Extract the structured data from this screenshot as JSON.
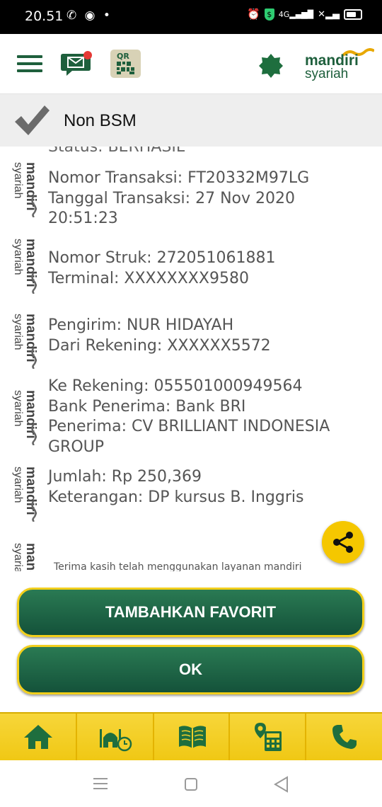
{
  "status_bar": {
    "time": "20.51",
    "left_icons": [
      "whatsapp-icon",
      "media-icon",
      "dot-icon"
    ],
    "right_icons": [
      "alarm-icon",
      "shield-icon",
      "signal-4g-icon",
      "signal-x-icon",
      "battery-icon"
    ],
    "network_label": "4G"
  },
  "header": {
    "menu_icon": "hamburger-icon",
    "mail_icon": "mail-notification-icon",
    "qr_label": "QR",
    "brand_name": "mandiri",
    "brand_sub": "syariah"
  },
  "section": {
    "title": "Non BSM",
    "icon": "checkmark-icon"
  },
  "receipt": {
    "cut_off_text": "Status: BERHASIL",
    "logo_mandiri": "mandiri",
    "logo_syariah": "syariah",
    "groups": [
      {
        "lines": [
          "Nomor Transaksi: FT20332M97LG",
          "Tanggal Transaksi: 27 Nov 2020",
          "20:51:23"
        ]
      },
      {
        "lines": [
          "Nomor Struk: 272051061881",
          "Terminal: XXXXXXXX9580"
        ]
      },
      {
        "lines": [
          "Pengirim: NUR HIDAYAH",
          "Dari Rekening: XXXXXX5572"
        ]
      },
      {
        "lines": [
          "Ke Rekening: 055501000949564",
          "Bank Penerima: Bank BRI",
          "Penerima: CV BRILLIANT INDONESIA",
          "GROUP"
        ]
      },
      {
        "lines": [
          "Jumlah: Rp 250,369",
          "Keterangan: DP kursus B. Inggris"
        ]
      }
    ],
    "footer_text": "Terima kasih telah menggunakan layanan mandiri"
  },
  "share_fab": {
    "icon": "share-icon"
  },
  "buttons": {
    "favorite": "TAMBAHKAN FAVORIT",
    "ok": "OK"
  },
  "bottom_nav": {
    "items": [
      {
        "icon": "home-icon"
      },
      {
        "icon": "mosque-clock-icon"
      },
      {
        "icon": "quran-book-icon"
      },
      {
        "icon": "map-calculator-icon"
      },
      {
        "icon": "phone-icon"
      }
    ]
  },
  "system_nav": {
    "items": [
      "recents-icon",
      "home-square-icon",
      "back-triangle-icon"
    ]
  },
  "colors": {
    "primary_green": "#1e5f3c",
    "accent_yellow": "#f5c700",
    "mail_badge": "#e53935"
  }
}
